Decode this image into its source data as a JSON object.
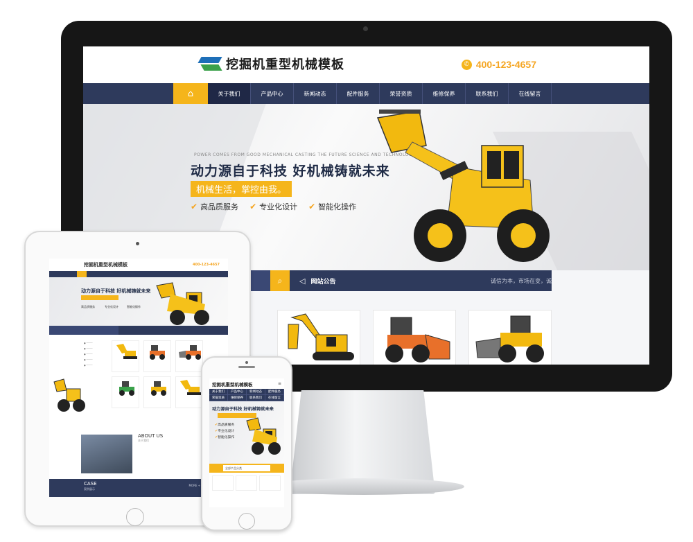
{
  "monitor": {
    "header": {
      "logo_text": "挖掘机重型机械模板",
      "phone": "400-123-4657"
    },
    "nav": {
      "items": [
        "关于我们",
        "产品中心",
        "新闻动态",
        "配件服务",
        "荣誉资质",
        "维修保养",
        "联系我们",
        "在线留言"
      ]
    },
    "banner": {
      "tagline": "POWER COMES FROM GOOD MECHANICAL CASTING THE FUTURE SCIENCE AND TECHNOLOGY",
      "title": "动力源自于科技 好机械铸就未来",
      "subtitle": "机械生活，掌控由我。",
      "features": [
        "高品质服务",
        "专业化设计",
        "智能化操作"
      ]
    },
    "notice": {
      "label": "网站公告",
      "text": "诚信为本，市场在变，诚"
    }
  },
  "tablet": {
    "header": {
      "logo_text": "挖掘机重型机械模板",
      "phone": "400-123-4657"
    },
    "banner": {
      "title": "动力源自于科技 好机械铸就未来",
      "features": [
        "高品质服务",
        "专业化设计",
        "智能化操作"
      ]
    },
    "about": {
      "title": "ABOUT US",
      "subtitle": "关于我们"
    },
    "case": {
      "title": "CASE",
      "subtitle": "案例展示",
      "more": "MORE +"
    }
  },
  "phone": {
    "header": {
      "logo_text": "挖掘机重型机械模板",
      "menu_icon": "≡"
    },
    "nav": [
      "关于我们",
      "产品中心",
      "新闻动态",
      "配件服务",
      "荣誉资质",
      "维修保养",
      "联系我们",
      "在线留言"
    ],
    "banner": {
      "title": "动力源自于科技 好机械铸就未来",
      "features": [
        "高品质服务",
        "专业化设计",
        "智能化操作"
      ]
    },
    "search": {
      "placeholder": "全部产品分类"
    }
  },
  "colors": {
    "accent": "#f5b51b",
    "navy": "#2e3a5c",
    "navy_light": "#3a4874"
  }
}
